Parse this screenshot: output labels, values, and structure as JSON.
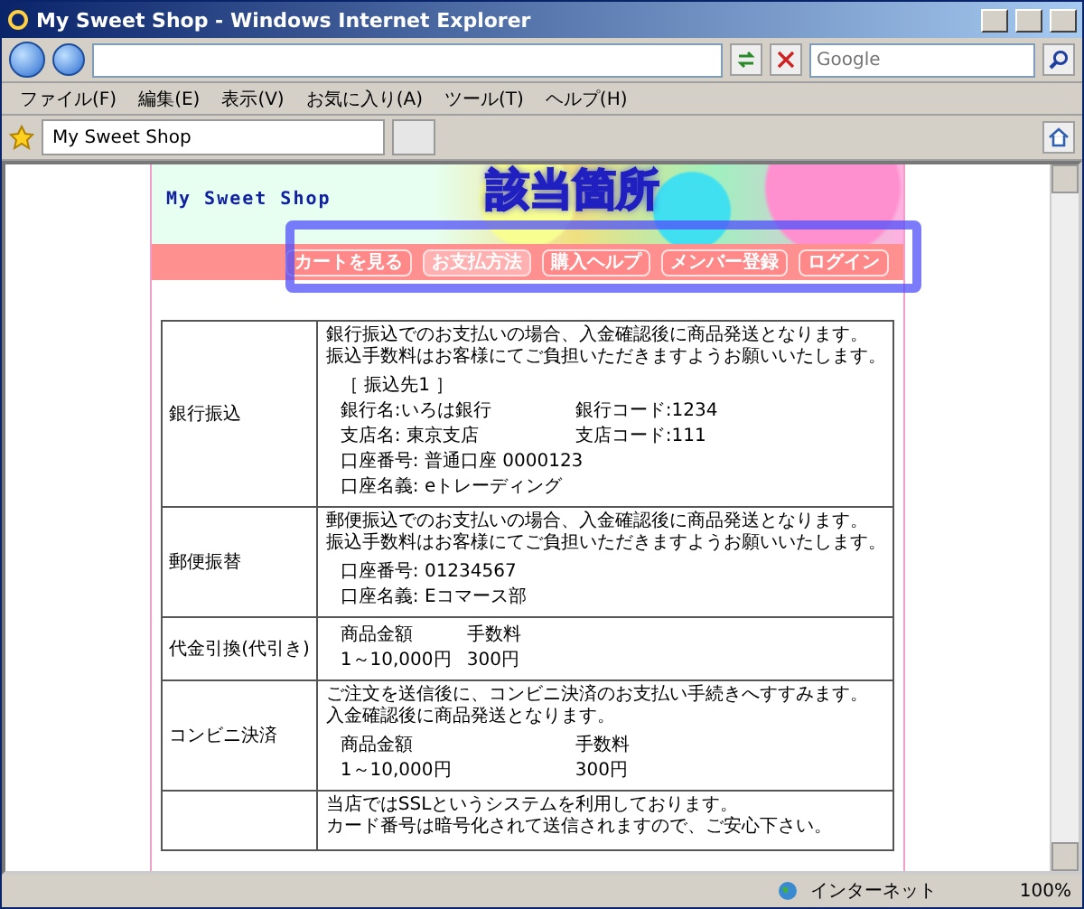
{
  "window": {
    "title": "My Sweet Shop - Windows Internet Explorer"
  },
  "toolbar": {
    "search_placeholder": "Google"
  },
  "menu": [
    "ファイル(F)",
    "編集(E)",
    "表示(V)",
    "お気に入り(A)",
    "ツール(T)",
    "ヘルプ(H)"
  ],
  "tabs": [
    {
      "label": "My Sweet Shop",
      "selected": true
    }
  ],
  "site": {
    "shop_name": "My Sweet Shop",
    "annotation": "該当箇所",
    "nav": [
      {
        "label": "カートを見る",
        "selected": false
      },
      {
        "label": "お支払方法",
        "selected": true
      },
      {
        "label": "購入ヘルプ",
        "selected": false
      },
      {
        "label": "メンバー登録",
        "selected": false
      },
      {
        "label": "ログイン",
        "selected": false
      }
    ]
  },
  "table": {
    "rows": [
      {
        "label": "銀行振込",
        "blocks": [
          {
            "kind": "text",
            "lines": [
              "銀行振込でのお支払いの場合、入金確認後に商品発送となります。",
              "振込手数料はお客様にてご負担いただきますようお願いいたします。"
            ]
          },
          {
            "kind": "line",
            "text": "［ 振込先1 ］"
          },
          {
            "kind": "pair",
            "left": "銀行名:いろは銀行",
            "right": "銀行コード:1234"
          },
          {
            "kind": "pair",
            "left": "支店名: 東京支店",
            "right": "支店コード:111"
          },
          {
            "kind": "line",
            "text": "口座番号: 普通口座  0000123"
          },
          {
            "kind": "line",
            "text": "口座名義: eトレーディング"
          }
        ]
      },
      {
        "label": "郵便振替",
        "blocks": [
          {
            "kind": "text",
            "lines": [
              "郵便振込でのお支払いの場合、入金確認後に商品発送となります。",
              "振込手数料はお客様にてご負担いただきますようお願いいたします。"
            ]
          },
          {
            "kind": "line",
            "text": "口座番号: 01234567"
          },
          {
            "kind": "line",
            "text": "口座名義: Eコマース部"
          }
        ]
      },
      {
        "label": "代金引換(代引き)",
        "blocks": [
          {
            "kind": "tight_pair",
            "left": "商品金額",
            "right": "手数料"
          },
          {
            "kind": "tight_pair",
            "left": "1～10,000円",
            "right": "300円"
          }
        ]
      },
      {
        "label": "コンビニ決済",
        "blocks": [
          {
            "kind": "text",
            "lines": [
              "ご注文を送信後に、コンビニ決済のお支払い手続きへすすみます。",
              "入金確認後に商品発送となります。"
            ]
          },
          {
            "kind": "pair",
            "left": "商品金額",
            "right": "手数料"
          },
          {
            "kind": "pair",
            "left": "1～10,000円",
            "right": "300円"
          }
        ]
      },
      {
        "label": "",
        "blocks": [
          {
            "kind": "text",
            "lines": [
              "当店ではSSLというシステムを利用しております。",
              "カード番号は暗号化されて送信されますので、ご安心下さい。"
            ]
          }
        ]
      }
    ]
  },
  "status_bar": {
    "zone": "インターネット",
    "zoom": "100%"
  }
}
